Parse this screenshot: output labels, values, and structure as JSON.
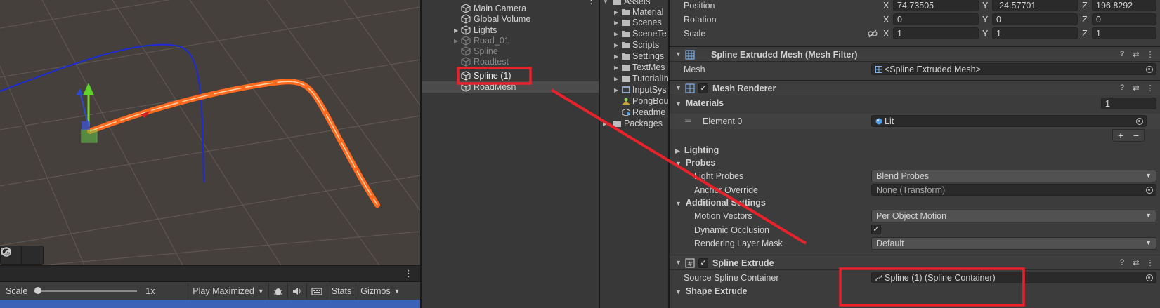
{
  "scene": {
    "overlay": [
      "camera-icon",
      "compass-icon"
    ],
    "kebab": "⋮"
  },
  "game": {
    "scale_label": "Scale",
    "scale_value": 0.0,
    "zoom": "1x",
    "play_mode": "Play Maximized",
    "stats": "Stats",
    "gizmos": "Gizmos",
    "kebab": "⋮"
  },
  "hierarchy": {
    "items": [
      {
        "name": "Main Camera",
        "dim": false,
        "has_children": false
      },
      {
        "name": "Global Volume",
        "dim": false,
        "has_children": false
      },
      {
        "name": "Lights",
        "dim": false,
        "has_children": true
      },
      {
        "name": "Road_01",
        "dim": true,
        "has_children": true
      },
      {
        "name": "Spline",
        "dim": true,
        "has_children": false
      },
      {
        "name": "Roadtest",
        "dim": true,
        "has_children": false
      },
      {
        "name": "Spline (1)",
        "dim": false,
        "has_children": false
      },
      {
        "name": "RoadMesh",
        "dim": false,
        "has_children": false
      }
    ],
    "kebab": "⋮"
  },
  "project": {
    "root": "Assets",
    "folders": [
      "Material",
      "Scenes",
      "SceneTe",
      "Scripts",
      "Settings",
      "TextMes",
      "TutorialIn",
      "InputSys"
    ],
    "files": [
      "PongBou",
      "Readme"
    ],
    "packages": "Packages"
  },
  "inspector": {
    "transform": {
      "position_label": "Position",
      "position": {
        "x": "74.73505",
        "y": "-24.57701",
        "z": "196.8292"
      },
      "rotation_label": "Rotation",
      "rotation": {
        "x": "0",
        "y": "0",
        "z": "0"
      },
      "scale_label": "Scale",
      "scale": {
        "x": "1",
        "y": "1",
        "z": "1"
      },
      "axis": {
        "x": "X",
        "y": "Y",
        "z": "Z"
      }
    },
    "mesh_filter": {
      "title": "Spline Extruded Mesh  (Mesh Filter)",
      "mesh_label": "Mesh",
      "mesh_value": "<Spline Extruded Mesh>"
    },
    "mesh_renderer": {
      "title": "Mesh Renderer",
      "materials_label": "Materials",
      "materials_count": "1",
      "element_label": "Element 0",
      "element_value": "Lit",
      "plus": "+",
      "minus": "−",
      "lighting_label": "Lighting",
      "probes_label": "Probes",
      "light_probes_label": "Light Probes",
      "light_probes_value": "Blend Probes",
      "anchor_label": "Anchor Override",
      "anchor_value": "None (Transform)",
      "additional_label": "Additional Settings",
      "motion_label": "Motion Vectors",
      "motion_value": "Per Object Motion",
      "occlusion_label": "Dynamic Occlusion",
      "layer_label": "Rendering Layer Mask",
      "layer_value": "Default"
    },
    "spline_extrude": {
      "title": "Spline Extrude",
      "source_label": "Source Spline Container",
      "source_value": "Spline (1) (Spline Container)",
      "shape_label": "Shape Extrude"
    },
    "header_icons": [
      "help-icon",
      "presets-icon",
      "more-icon"
    ]
  },
  "colors": {
    "highlight": "#e8222a",
    "spline_orange": "#ff6a1f",
    "selection_blue": "#1c2bd6"
  }
}
